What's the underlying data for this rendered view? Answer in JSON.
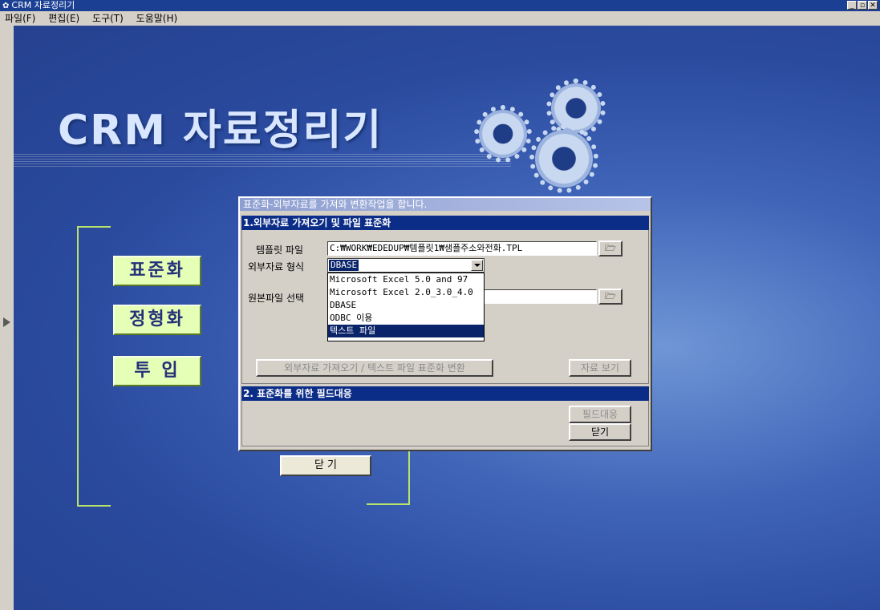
{
  "window": {
    "title": "CRM 자료정리기",
    "app_icon": "gear-icon",
    "controls": [
      "minimize",
      "restore",
      "close"
    ],
    "control_glyphs": {
      "minimize": "_",
      "restore": "▫",
      "close": "✕"
    }
  },
  "menu": [
    "파일(F)",
    "편집(E)",
    "도구(T)",
    "도움말(H)"
  ],
  "brand": {
    "logo_text": "CRM 자료정리기"
  },
  "side_buttons": [
    "표준화",
    "정형화",
    "투 입"
  ],
  "close_button": "닫 기",
  "dialog": {
    "title": "표준화-외부자료를 가져와 변환작업을 합니다.",
    "section1": {
      "header": "1.외부자료 가져오기 및 파일 표준화",
      "template_label": "템플릿 파일",
      "template_value": "C:₩WORK₩EDEDUP₩템플릿1₩샘플주소와전화.TPL",
      "format_label": "외부자료 형식",
      "format_value": "DBASE",
      "source_label": "원본파일 선택",
      "source_value": "",
      "format_options": [
        "Microsoft Excel 5.0 and 97",
        "Microsoft Excel 2.0_3.0_4.0",
        "DBASE",
        "ODBC 이용",
        "텍스트 파일"
      ],
      "highlighted_option": "텍스트 파일",
      "import_button": "외부자료 가져오기 / 텍스트 파일 표준화 변환",
      "view_button": "자료 보기",
      "browse_glyph": "🗁"
    },
    "section2": {
      "header": "2. 표준화를 위한 필드대응",
      "field_map_button": "필드대응",
      "close_button": "닫기"
    }
  },
  "colors": {
    "accent_green": "#b9e26a",
    "side_button_bg": "#e5ffb6",
    "side_button_text": "#24307a",
    "section_header_bg": "#0b2c87",
    "selection": "#0a246a"
  }
}
